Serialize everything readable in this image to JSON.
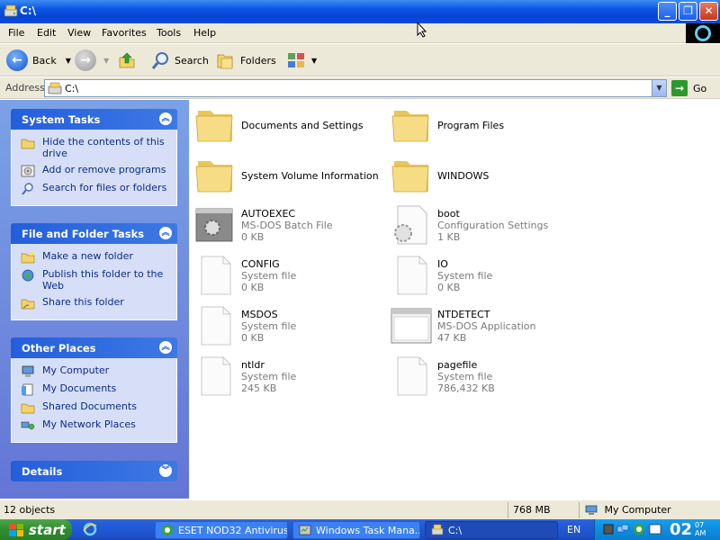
{
  "window": {
    "title": "C:\\",
    "minimize_glyph": "_",
    "maximize_glyph": "❐",
    "close_glyph": "✕"
  },
  "menu": [
    "File",
    "Edit",
    "View",
    "Favorites",
    "Tools",
    "Help"
  ],
  "toolbar": {
    "back_label": "Back",
    "search_label": "Search",
    "folders_label": "Folders"
  },
  "address": {
    "label": "Address",
    "value": "C:\\",
    "go_label": "Go"
  },
  "left_pane": {
    "system_tasks": {
      "title": "System Tasks",
      "items": [
        {
          "label": "Hide the contents of this drive",
          "icon": "folder-icon"
        },
        {
          "label": "Add or remove programs",
          "icon": "cd-icon"
        },
        {
          "label": "Search for files or folders",
          "icon": "search-icon"
        }
      ]
    },
    "file_folder_tasks": {
      "title": "File and Folder Tasks",
      "items": [
        {
          "label": "Make a new folder",
          "icon": "new-folder-icon"
        },
        {
          "label": "Publish this folder to the Web",
          "icon": "globe-icon"
        },
        {
          "label": "Share this folder",
          "icon": "share-icon"
        }
      ]
    },
    "other_places": {
      "title": "Other Places",
      "items": [
        {
          "label": "My Computer",
          "icon": "computer-icon"
        },
        {
          "label": "My Documents",
          "icon": "documents-icon"
        },
        {
          "label": "Shared Documents",
          "icon": "folder-icon"
        },
        {
          "label": "My Network Places",
          "icon": "network-icon"
        }
      ]
    },
    "details": {
      "title": "Details"
    }
  },
  "files": [
    {
      "name": "Documents and Settings",
      "kind": "folder"
    },
    {
      "name": "Program Files",
      "kind": "folder"
    },
    {
      "name": "System Volume Information",
      "kind": "folder"
    },
    {
      "name": "WINDOWS",
      "kind": "folder"
    },
    {
      "name": "AUTOEXEC",
      "type": "MS-DOS Batch File",
      "size": "0 KB",
      "kind": "batch"
    },
    {
      "name": "boot",
      "type": "Configuration Settings",
      "size": "1 KB",
      "kind": "config"
    },
    {
      "name": "CONFIG",
      "type": "System file",
      "size": "0 KB",
      "kind": "file"
    },
    {
      "name": "IO",
      "type": "System file",
      "size": "0 KB",
      "kind": "file"
    },
    {
      "name": "MSDOS",
      "type": "System file",
      "size": "0 KB",
      "kind": "file"
    },
    {
      "name": "NTDETECT",
      "type": "MS-DOS Application",
      "size": "47 KB",
      "kind": "app"
    },
    {
      "name": "ntldr",
      "type": "System file",
      "size": "245 KB",
      "kind": "file"
    },
    {
      "name": "pagefile",
      "type": "System file",
      "size": "786,432 KB",
      "kind": "file"
    }
  ],
  "status": {
    "objects": "12 objects",
    "size": "768 MB",
    "location": "My Computer"
  },
  "taskbar": {
    "start_label": "start",
    "buttons": [
      {
        "label": "ESET NOD32 Antivirus",
        "active": false
      },
      {
        "label": "Windows Task Mana...",
        "active": false
      },
      {
        "label": "C:\\",
        "active": true
      }
    ],
    "language": "EN",
    "clock_hour": "02",
    "clock_min": "07",
    "clock_ampm": "AM"
  },
  "colors": {
    "title_blue": "#0a54e0",
    "pane_blue": "#6d8ddf",
    "task_head": "#245edb",
    "link_blue": "#0c2a8a",
    "start_green": "#2f8c2e"
  }
}
